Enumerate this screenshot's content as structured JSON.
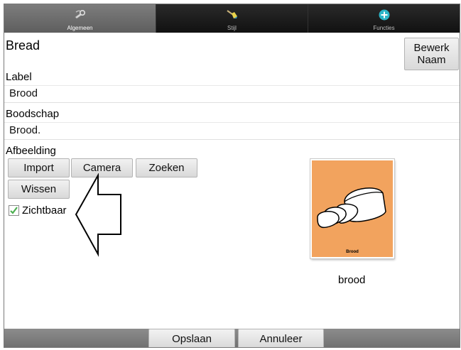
{
  "tabs": [
    {
      "label": "Algemeen",
      "icon": "wrench-icon",
      "active": true
    },
    {
      "label": "Stijl",
      "icon": "paintbrush-icon",
      "active": false
    },
    {
      "label": "Functies",
      "icon": "plus-circle-icon",
      "active": false
    }
  ],
  "page": {
    "title": "Bread",
    "rename_button": [
      "Bewerk",
      "Naam"
    ]
  },
  "label": {
    "heading": "Label",
    "value": "Brood"
  },
  "message": {
    "heading": "Boodschap",
    "value": "Brood."
  },
  "image": {
    "heading": "Afbeelding",
    "buttons": {
      "import": "Import",
      "camera": "Camera",
      "search": "Zoeken",
      "clear": "Wissen"
    },
    "card_caption": "Brood",
    "caption": "brood"
  },
  "visible": {
    "label": "Zichtbaar",
    "checked": true
  },
  "footer": {
    "save": "Opslaan",
    "cancel": "Annuleer"
  },
  "colors": {
    "card_bg": "#f2a35e",
    "check": "#4caf50",
    "accent": "#2bb5c8"
  }
}
